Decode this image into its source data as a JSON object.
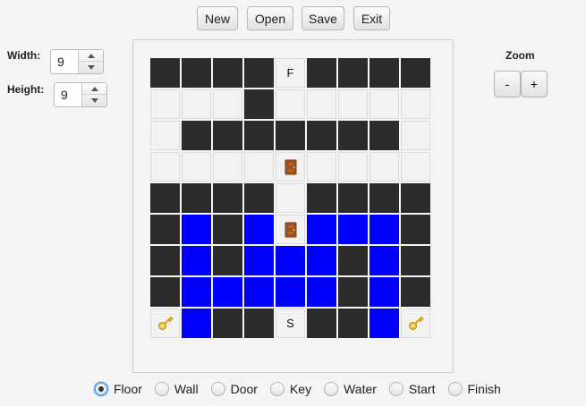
{
  "toolbar": {
    "new_label": "New",
    "open_label": "Open",
    "save_label": "Save",
    "exit_label": "Exit"
  },
  "dimensions": {
    "width_label": "Width:",
    "width_value": "9",
    "height_label": "Height:",
    "height_value": "9"
  },
  "zoom": {
    "label": "Zoom",
    "minus_label": "-",
    "plus_label": "+"
  },
  "grid": {
    "legend": {
      "W": "wall",
      ".": "floor",
      "B": "water",
      "D": "door",
      "K": "key",
      "S": "start",
      "F": "finish"
    },
    "rows": [
      "WWWWFWWWW",
      "...W.....",
      ".WWWWWWW.",
      "....D....",
      "WWWW.WWWW",
      "WBWBDBBBW",
      "WBWBBBWBW",
      "WBBBBBWBW",
      "KBWWSWWBK"
    ],
    "start_text": "S",
    "finish_text": "F",
    "door_icon": "door-icon",
    "key_icon": "key-icon",
    "colors": {
      "wall": "#2b2b2b",
      "floor": "#f2f2f2",
      "water": "#0000ff"
    }
  },
  "tile_types": {
    "selected": "Floor",
    "options": [
      "Floor",
      "Wall",
      "Door",
      "Key",
      "Water",
      "Start",
      "Finish"
    ]
  }
}
